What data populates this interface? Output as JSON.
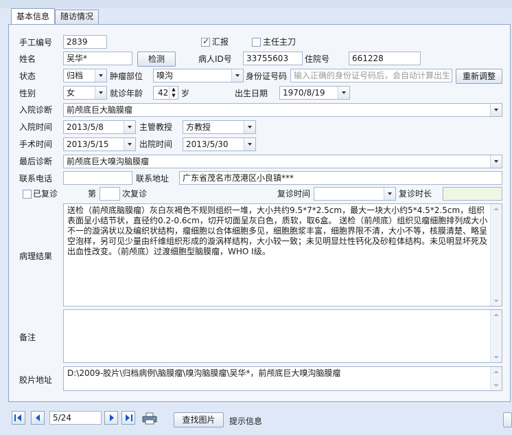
{
  "tabs": [
    {
      "label": "基本信息",
      "active": true
    },
    {
      "label": "随访情况",
      "active": false
    }
  ],
  "form": {
    "record_no_label": "手工编号",
    "record_no": "2839",
    "report_label": "汇报",
    "report_checked": true,
    "chief_surgeon_label": "主任主刀",
    "chief_surgeon_checked": false,
    "name_label": "姓名",
    "name": "吴华*",
    "detect_button": "检测",
    "patient_id_label": "病人ID号",
    "patient_id": "33755603",
    "hospital_no_label": "住院号",
    "hospital_no": "661228",
    "status_label": "状态",
    "status": "归档",
    "tumor_site_label": "肿瘤部位",
    "tumor_site": "嗅沟",
    "id_card_label": "身份证号码",
    "id_card_placeholder": "输入正确的身份证号码后，会自动计算出生日",
    "readjust_button": "重新调整",
    "gender_label": "性别",
    "gender": "女",
    "age_label": "就诊年龄",
    "age": "42",
    "age_unit": "岁",
    "birth_label": "出生日期",
    "birth_date": "1970/8/19",
    "admit_diag_label": "入院诊断",
    "admit_diag": "前颅底巨大脑膜瘤",
    "admit_time_label": "入院时间",
    "admit_time": "2013/5/8",
    "professor_label": "主管教授",
    "professor": "方教授",
    "surgery_time_label": "手术时间",
    "surgery_time": "2013/5/15",
    "discharge_time_label": "出院时间",
    "discharge_time": "2013/5/30",
    "final_diag_label": "最后诊断",
    "final_diag": "前颅底巨大嗅沟脑膜瘤",
    "phone_label": "联系电话",
    "phone": "",
    "address_label": "联系地址",
    "address": "广东省茂名市茂港区小良镇***",
    "revisit_label": "已复诊",
    "revisit_checked": false,
    "revisit_no_prefix": "第",
    "revisit_no": "",
    "revisit_no_suffix": "次复诊",
    "revisit_time_label": "复诊时间",
    "revisit_time": "",
    "revisit_duration_label": "复诊时长",
    "revisit_duration": "",
    "pathology_label": "病理结果",
    "pathology": "送检（前颅底脑膜瘤）灰白灰褐色不规则组织一堆，大小共约9.5*7*2.5cm，最大一块大小约5*4.5*2.5cm，组织表面呈小结节状，直径约0.2-0.6cm，切开切面呈灰白色，质软，取6盒。 送检（前颅底）组织见瘤细胞排列成大小不一的漩涡状以及编织状结构，瘤细胞以合体细胞多见，细胞胞浆丰富，细胞界限不清，大小不等，核膜清楚、略呈空泡样，另可见少量由纤维组织形成的漩涡样结构，大小较一致；未见明显灶性钙化及砂粒体结构。未见明显坏死及出血性改变。（前颅底）过渡细胞型脑膜瘤，WHO Ⅰ级。",
    "remarks_label": "备注",
    "remarks": "",
    "film_path_label": "胶片地址",
    "film_path": "D:\\2009-胶片\\归档病例\\脑膜瘤\\嗅沟脑膜瘤\\吴华*，前颅底巨大嗅沟脑膜瘤"
  },
  "footer": {
    "page_indicator": "5/24",
    "find_image_button": "查找图片",
    "hint_label": "提示信息"
  },
  "icons": {
    "first": "first-page-icon",
    "prev": "prev-page-icon",
    "next": "next-page-icon",
    "last": "last-page-icon",
    "print": "printer-icon"
  },
  "colors": {
    "background": "#dfe8f6",
    "panel": "#f3f6fb",
    "border": "#8fa3c1",
    "revisit_duration_bg": "#eef7e4"
  }
}
